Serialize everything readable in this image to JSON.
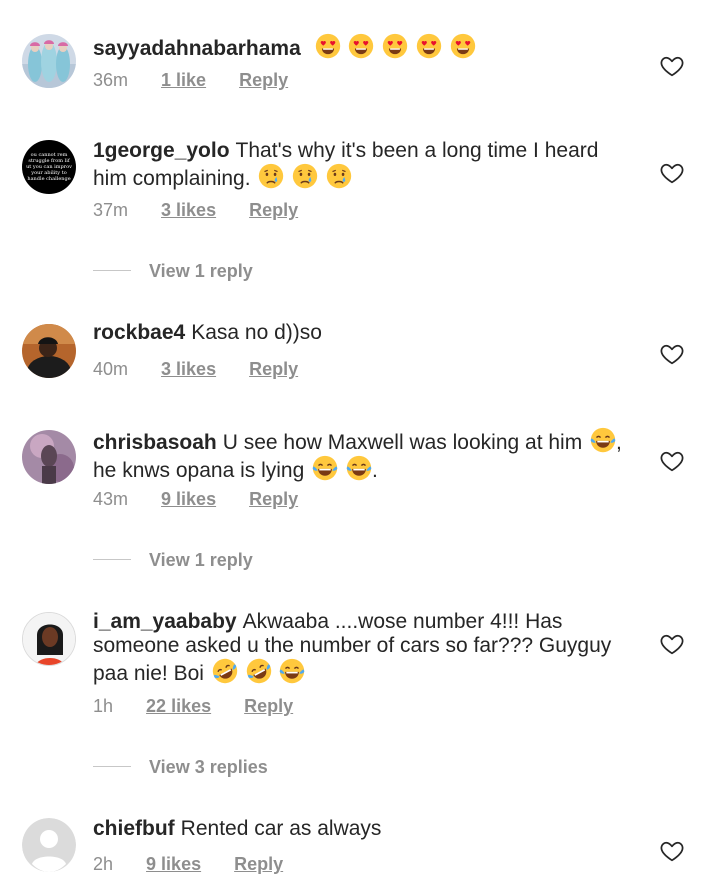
{
  "comments": [
    {
      "username": "sayyadahnabarhama",
      "text": "",
      "emojis": [
        "heart-eyes",
        "heart-eyes",
        "heart-eyes",
        "heart-eyes",
        "heart-eyes"
      ],
      "time": "36m",
      "likes": "1 like",
      "reply": "Reply"
    },
    {
      "username": "1george_yolo",
      "text": "That's why it's been a long time I heard him complaining.",
      "emojis": [
        "crying",
        "crying",
        "crying"
      ],
      "time": "37m",
      "likes": "3 likes",
      "reply": "Reply",
      "view_replies": "View 1 reply",
      "avatar_text": [
        "ou cannot rem",
        "struggle from lif",
        "ut you can improv",
        "your ability to",
        "handle challenge"
      ]
    },
    {
      "username": "rockbae4",
      "text": "Kasa no d))so",
      "emojis": [],
      "time": "40m",
      "likes": "3 likes",
      "reply": "Reply"
    },
    {
      "username": "chrisbasoah",
      "text": "U see how Maxwell was looking at him",
      "text_after_1": ", he knws opana is lying",
      "text_after_2": ".",
      "emojis": [
        "tears-of-joy",
        "tears-of-joy",
        "tears-of-joy"
      ],
      "time": "43m",
      "likes": "9 likes",
      "reply": "Reply",
      "view_replies": "View 1 reply"
    },
    {
      "username": "i_am_yaababy",
      "text": "Akwaaba ....wose number 4!!! Has someone asked u the number of cars so far??? Guyguy paa nie! Boi",
      "emojis": [
        "rofl",
        "rofl",
        "tears-of-joy"
      ],
      "time": "1h",
      "likes": "22 likes",
      "reply": "Reply",
      "view_replies": "View 3 replies"
    },
    {
      "username": "chiefbuf",
      "text": "Rented car as always",
      "emojis": [],
      "time": "2h",
      "likes": "9 likes",
      "reply": "Reply"
    }
  ],
  "colors": {
    "text": "#262626",
    "secondary": "#8e8e8e",
    "divider": "#c7c7c7",
    "emoji_yellow": "#FFC83D",
    "heart_red": "#E8112D"
  },
  "icons": {
    "like": "heart-outline-icon",
    "default_avatar": "default-avatar-icon"
  }
}
